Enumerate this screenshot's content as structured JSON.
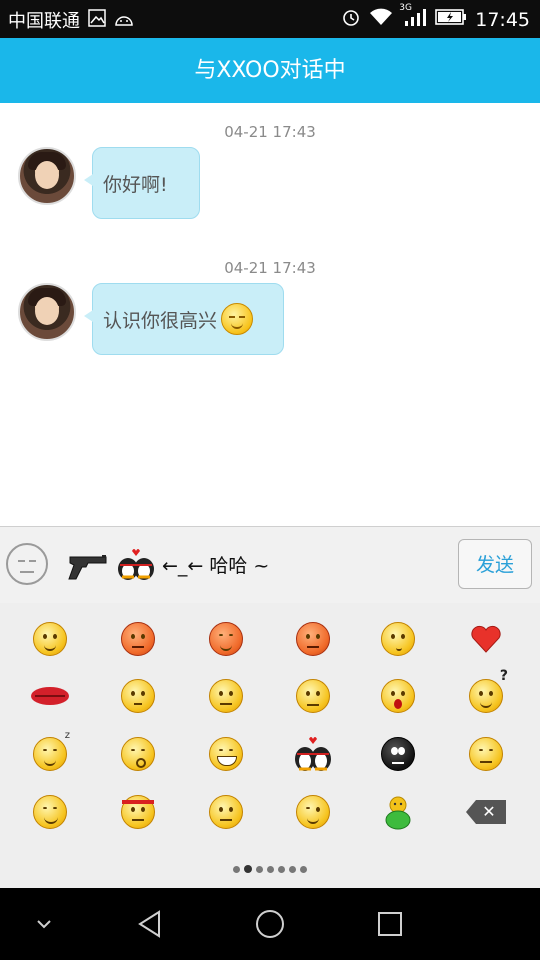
{
  "status_bar": {
    "carrier": "中国联通",
    "network": "3G",
    "time": "17:45"
  },
  "title_bar": {
    "title": "与XXOO对话中"
  },
  "messages": [
    {
      "timestamp": "04-21 17:43",
      "text": "你好啊!",
      "emoji": ""
    },
    {
      "timestamp": "04-21 17:43",
      "text": "认识你很高兴",
      "emoji": "shy-smile-emoji"
    }
  ],
  "input": {
    "composed_text": "←_← 哈哈 ~",
    "composed_emojis": [
      "pistol-emoji",
      "kissing-penguins-emoji"
    ],
    "send_label": "发送"
  },
  "emoji_panel": {
    "rows": [
      [
        "smile-emoji",
        "angry-emoji",
        "sleepy-red-emoji",
        "sweat-emoji",
        "think-emoji",
        "heart-icon"
      ],
      [
        "lips-icon",
        "speechless-emoji",
        "puzzled-emoji",
        "sad-emoji",
        "surprised-emoji",
        "question-emoji"
      ],
      [
        "sleep-emoji",
        "kiss-emoji",
        "grin-emoji",
        "kissing-penguins-emoji",
        "black-face-emoji",
        "awkward-emoji"
      ],
      [
        "smug-emoji",
        "headband-emoji",
        "furious-emoji",
        "wink-emoji",
        "green-bird-emoji",
        "backspace-icon"
      ]
    ],
    "page_count": 7,
    "active_page": 2
  },
  "colors": {
    "accent": "#1ab7ea",
    "bubble": "#c9eef8",
    "send_text": "#2aa0d8"
  }
}
